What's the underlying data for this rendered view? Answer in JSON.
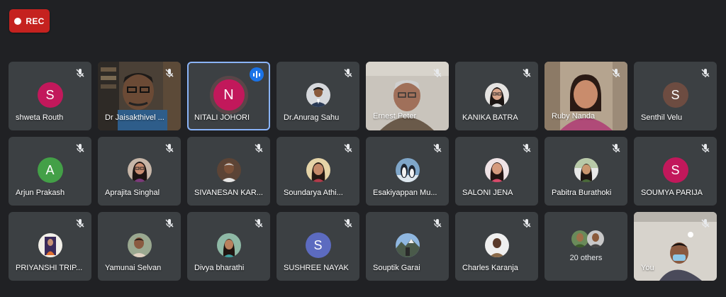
{
  "rec": {
    "label": "REC",
    "color": "#c5221f"
  },
  "participants": [
    {
      "name": "shweta Routh",
      "letter": "S",
      "color": "#c2185b",
      "kind": "letter"
    },
    {
      "name": "Dr Jaisakthivel ...",
      "kind": "video"
    },
    {
      "name": "NITALI JOHORI",
      "letter": "N",
      "color": "#c2185b",
      "kind": "letter",
      "active": true
    },
    {
      "name": "Dr.Anurag Sahu",
      "kind": "photo"
    },
    {
      "name": "Ernest Peter",
      "kind": "video"
    },
    {
      "name": "KANIKA BATRA",
      "kind": "photo"
    },
    {
      "name": "Ruby Nanda",
      "kind": "video"
    },
    {
      "name": "Senthil Velu",
      "letter": "S",
      "color": "#6d4c41",
      "kind": "letter"
    },
    {
      "name": "Arjun Prakash",
      "letter": "A",
      "color": "#43a047",
      "kind": "letter"
    },
    {
      "name": "Aprajita Singhal",
      "kind": "photo"
    },
    {
      "name": "SIVANESAN KAR...",
      "kind": "photo"
    },
    {
      "name": "Soundarya Athi...",
      "kind": "photo"
    },
    {
      "name": "Esakiyappan Mu...",
      "kind": "photo"
    },
    {
      "name": "SALONI JENA",
      "kind": "photo"
    },
    {
      "name": "Pabitra Burathoki",
      "kind": "photo"
    },
    {
      "name": "SOUMYA PARIJA",
      "letter": "S",
      "color": "#c2185b",
      "kind": "letter"
    },
    {
      "name": "PRIYANSHI TRIP...",
      "kind": "photo"
    },
    {
      "name": "Yamunai Selvan",
      "kind": "photo"
    },
    {
      "name": "Divya bharathi",
      "kind": "photo"
    },
    {
      "name": "SUSHREE NAYAK",
      "letter": "S",
      "color": "#5c6bc0",
      "kind": "letter"
    },
    {
      "name": "Souptik Garai",
      "kind": "photo"
    },
    {
      "name": "Charles Karanja",
      "kind": "photo"
    },
    {
      "name": "",
      "kind": "others",
      "others_label": "20 others"
    },
    {
      "name": "You",
      "kind": "video"
    }
  ]
}
